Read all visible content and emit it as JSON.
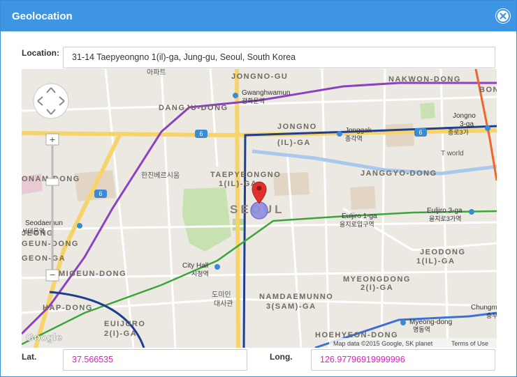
{
  "dialog": {
    "title": "Geolocation"
  },
  "location": {
    "label": "Location:",
    "value": "31-14 Taepyeongno 1(il)-ga, Jung-gu, Seoul, South Korea"
  },
  "coordinates": {
    "lat_label": "Lat.",
    "lat_value": "37.566535",
    "long_label": "Long.",
    "long_value": "126.97796919999996"
  },
  "map": {
    "district_labels": {
      "jongno_gu": "JONGNO-GU",
      "nakwon_dong": "NAKWON-DONG",
      "bong": "BONG",
      "danggju_dong": "DANGJU-DONG",
      "jongno_ilga_1": "JONGNO",
      "jongno_ilga_2": "(IL)-GA",
      "taepyeongno_1": "TAEPYEONGNO",
      "taepyeongno_2": "1(IL)-GA",
      "onam_dong": "ONAM-DONG",
      "seoul": "SEOUL",
      "janggyo_dong": "JANGGYO-DONG",
      "jeodong_1": "JEODONG",
      "jeodong_2": "1(IL)-GA",
      "geun_dong": "GEUN-DONG",
      "migeun_dong": "MIGEUN-DONG",
      "myeongdong_1": "MYEONGDONG",
      "myeongdong_2": "2(I)-GA",
      "namdaemunno_1": "NAMDAEMUNNO",
      "namdaemunno_2": "3(SAM)-GA",
      "hap_dong": "HAP-DONG",
      "euijuro_1": "EUIJURO",
      "euijuro_2": "2(I)-GA",
      "hoehyeon_dong": "HOEHYEON-DONG",
      "jeong": "JEONG",
      "geon_ga": "GEON-GA"
    },
    "station_labels": {
      "gwanghwamun": "Gwanghwamun",
      "gwanghwamun_kr": "광화문역",
      "jonggak": "Jonggak",
      "jonggak_kr": "종각역",
      "jongno3ga": "Jongno",
      "jongno3ga_2": "3-ga",
      "jongno3ga_kr": "종로3가",
      "seodaemun": "Seodaemun",
      "seodaemun_kr": "서대문역",
      "euljiro1ga": "Euljiro 1-ga",
      "euljiro1ga_kr": "을지로입구역",
      "euljiro3ga": "Euljiro 3-ga",
      "euljiro3ga_kr": "을지로3가역",
      "cityhall": "City Hall",
      "cityhall_kr": "시청역",
      "myeongdong": "Myeong-dong",
      "myeongdong_kr": "명동역",
      "chungmuro": "Chungm",
      "chungmuro_kr": "충무"
    },
    "place_labels": {
      "apateu": "아파트",
      "hanjin": "한진베르시움",
      "tworld": "T world",
      "domiinn": "도미인",
      "domiinn_2": "대사관"
    },
    "route_shields": [
      "6",
      "6",
      "6"
    ],
    "attribution": "Map data ©2015 Google, SK planet",
    "terms": "Terms of Use",
    "google_logo": "Google",
    "zoom_in": "+",
    "zoom_out": "−"
  }
}
